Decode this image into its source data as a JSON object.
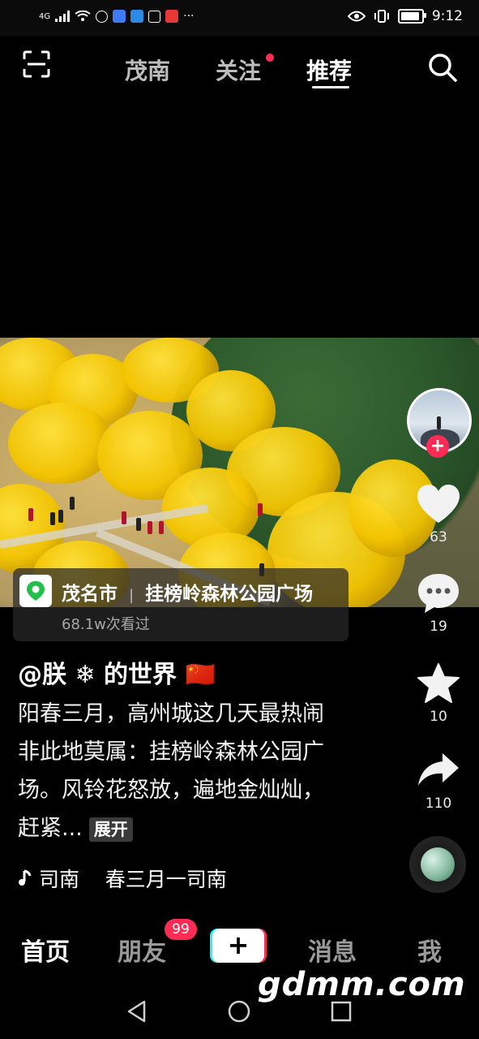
{
  "status_bar": {
    "network": "4G",
    "time": "9:12"
  },
  "top_nav": {
    "tabs": [
      {
        "label": "茂南",
        "active": false
      },
      {
        "label": "关注",
        "active": false,
        "has_dot": true
      },
      {
        "label": "推荐",
        "active": true
      }
    ],
    "icons": [
      "scan-icon",
      "search-icon"
    ]
  },
  "location": {
    "city": "茂名市",
    "place": "挂榜岭森林公园广场",
    "views": "68.1w次看过"
  },
  "rail": {
    "likes": "63",
    "comments": "19",
    "favorites": "10",
    "shares": "110"
  },
  "post": {
    "author": "@朕 ❄ 的世界 🇨🇳",
    "caption": "阳春三月，高州城这几天最热闹非此地莫属：挂榜岭森林公园广场。风铃花怒放，遍地金灿灿，赶紧...",
    "expand_label": "展开",
    "music": "司南    春三月一司南"
  },
  "bottom_nav": {
    "items": [
      {
        "label": "首页",
        "active": true
      },
      {
        "label": "朋友",
        "active": false
      },
      {
        "label": "消息",
        "active": false
      },
      {
        "label": "我",
        "active": false
      }
    ],
    "friends_badge": "99",
    "plus_label": "+"
  },
  "watermark": "gdmm.com",
  "colors": {
    "accent_red": "#fe2c55",
    "accent_cyan": "#25f4ee"
  }
}
